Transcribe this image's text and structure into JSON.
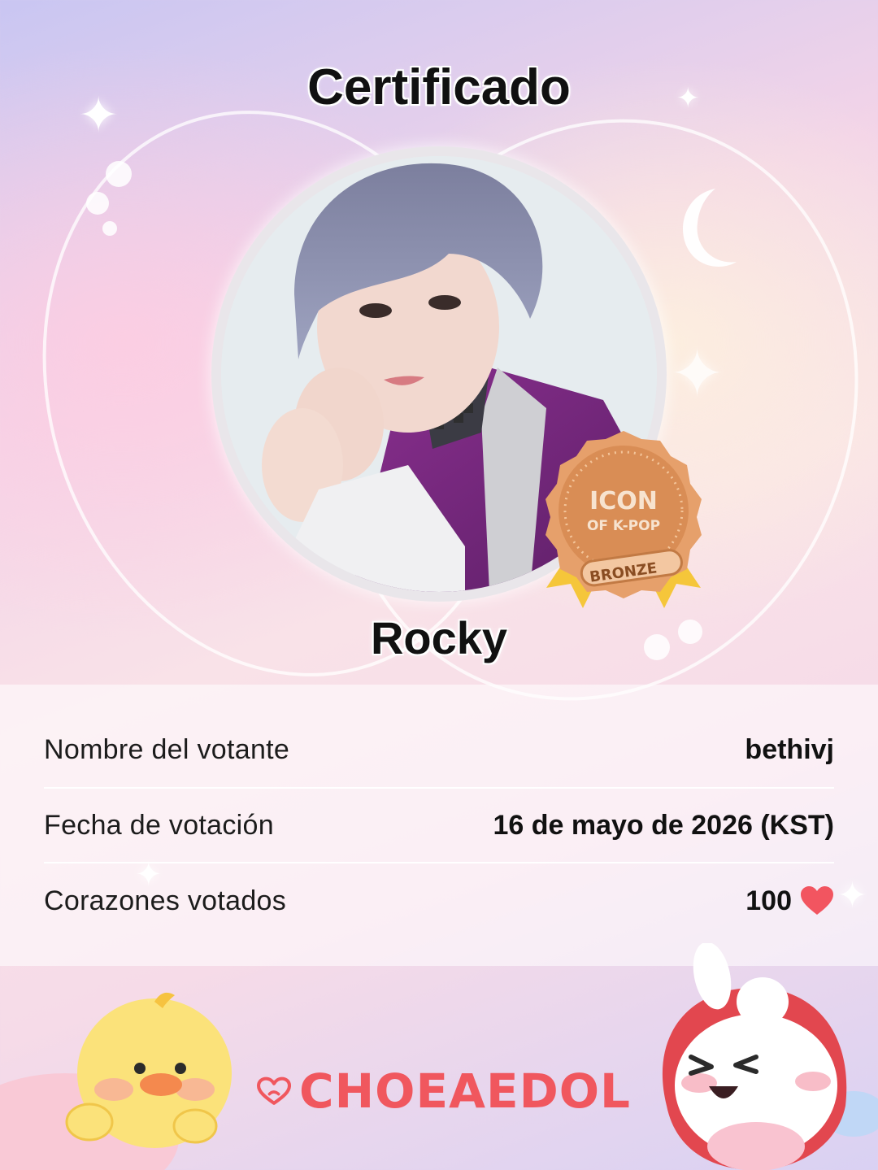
{
  "header": {
    "title": "Certificado"
  },
  "idol": {
    "name": "Rocky"
  },
  "badge": {
    "line1": "ICON",
    "line2": "OF K-POP",
    "tier": "BRONZE"
  },
  "details": {
    "voter_label": "Nombre del votante",
    "voter_value": "bethivj",
    "date_label": "Fecha de votación",
    "date_value": "16 de mayo de 2026 (KST)",
    "hearts_label": "Corazones votados",
    "hearts_value": "100"
  },
  "brand": {
    "name": "CHOEAEDOL"
  },
  "colors": {
    "brand_red": "#f0575e",
    "badge_bronze": "#e09a63",
    "heart_red": "#f25560"
  },
  "icons": [
    "heart-icon",
    "brand-logo-icon",
    "moon-icon",
    "sparkle-icon",
    "medal-icon"
  ]
}
